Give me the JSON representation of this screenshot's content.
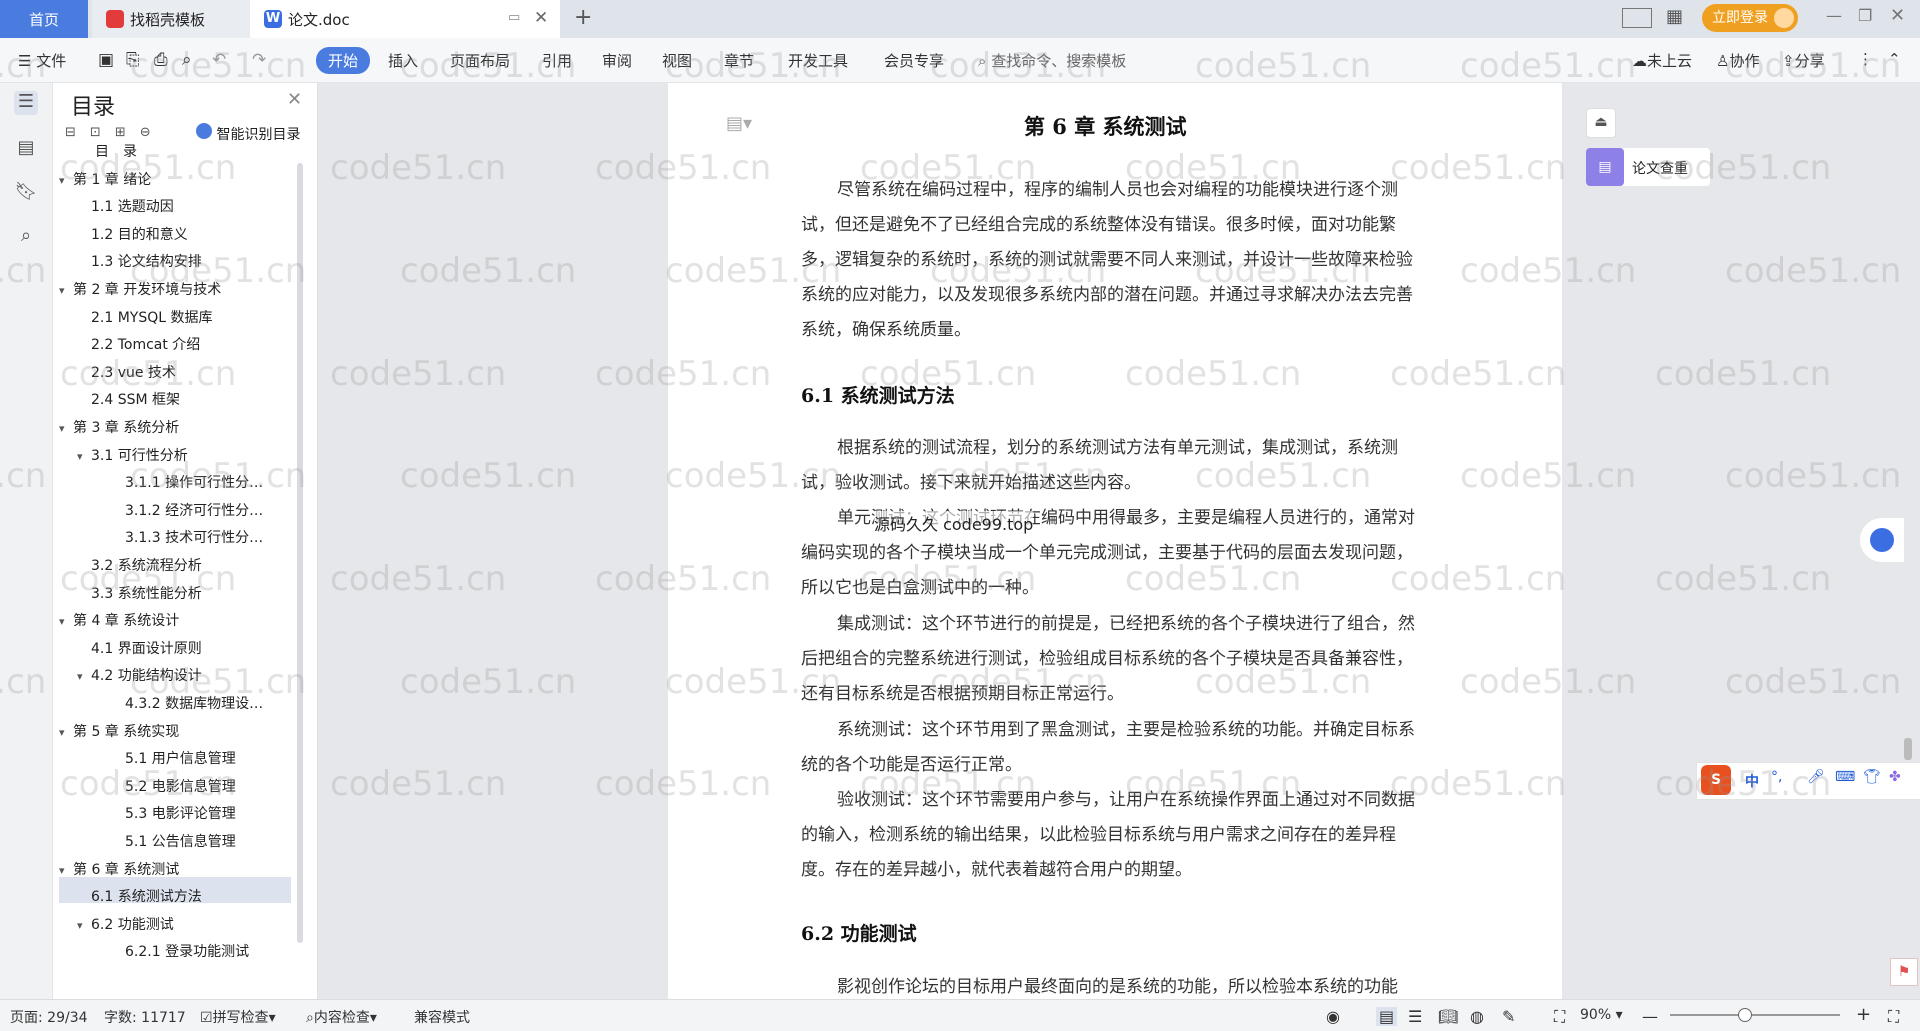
{
  "tabs": {
    "home": "首页",
    "template": "找稻壳模板",
    "doc": "论文.doc",
    "login": "立即登录"
  },
  "toolbar": {
    "file": "文件",
    "menus": [
      "开始",
      "插入",
      "页面布局",
      "引用",
      "审阅",
      "视图",
      "章节",
      "开发工具",
      "会员专享"
    ],
    "search_placeholder": "查找命令、搜索模板",
    "cloud": "未上云",
    "collab": "协作",
    "share": "分享"
  },
  "outline": {
    "title": "目录",
    "smart": "智能识别目录",
    "items": [
      "目　录",
      "第 1 章  绪论",
      "1.1 选题动因",
      "1.2 目的和意义",
      "1.3 论文结构安排",
      "第 2 章  开发环境与技术",
      "2.1 MYSQL 数据库",
      "2.2 Tomcat 介绍",
      "2.3 vue 技术",
      "2.4 SSM 框架",
      "第 3 章  系统分析",
      "3.1 可行性分析",
      "3.1.1 操作可行性分…",
      "3.1.2 经济可行性分…",
      "3.1.3 技术可行性分…",
      "3.2 系统流程分析",
      "3.3 系统性能分析",
      "第 4 章  系统设计",
      "4.1 界面设计原则",
      "4.2 功能结构设计",
      "4.3.2  数据库物理设…",
      "第 5 章  系统实现",
      "5.1 用户信息管理",
      "5.2  电影信息管理",
      "5.3 电影评论管理",
      "5.1 公告信息管理",
      "第 6 章  系统测试",
      "6.1  系统测试方法",
      "6.2  功能测试",
      "6.2.1  登录功能测试"
    ]
  },
  "document": {
    "chapter_title": "第 6 章  系统测试",
    "intro": "尽管系统在编码过程中，程序的编制人员也会对编程的功能模块进行逐个测试，但还是避免不了已经组合完成的系统整体没有错误。很多时候，面对功能繁多，逻辑复杂的系统时，系统的测试就需要不同人来测试，并设计一些故障来检验系统的应对能力，以及发现很多系统内部的潜在问题。并通过寻求解决办法去完善系统，确保系统质量。",
    "h61": "6.1  系统测试方法",
    "p1": "根据系统的测试流程，划分的系统测试方法有单元测试，集成测试，系统测试，验收测试。接下来就开始描述这些内容。",
    "p2": "单元测试：这个测试环节在编码中用得最多，主要是编程人员进行的，通常对编码实现的各个子模块当成一个单元完成测试，主要基于代码的层面去发现问题，所以它也是白盒测试中的一种。",
    "p3": "集成测试：这个环节进行的前提是，已经把系统的各个子模块进行了组合，然后把组合的完整系统进行测试，检验组成目标系统的各个子模块是否具备兼容性，还有目标系统是否根据预期目标正常运行。",
    "p4": "系统测试：这个环节用到了黑盒测试，主要是检验系统的功能。并确定目标系统的各个功能是否运行正常。",
    "p5": "验收测试：这个环节需要用户参与，让用户在系统操作界面上通过对不同数据的输入，检测系统的输出结果，以此检验目标系统与用户需求之间存在的差异程度。存在的差异越小，就代表着越符合用户的期望。",
    "h62": "6.2  功能测试",
    "p6": "影视创作论坛的目标用户最终面向的是系统的功能，所以检验本系统的功能",
    "overlay": "源码久久  code99.top"
  },
  "right_panel": {
    "check": "论文查重"
  },
  "ime": [
    "中",
    "°,"
  ],
  "watermark": "code51.cn",
  "status": {
    "page": "页面: 29/34",
    "words": "字数: 11717",
    "spell": "拼写检查",
    "content": "内容检查",
    "compat": "兼容模式",
    "zoom": "90%"
  },
  "colors": {
    "accent": "#4a7ce0",
    "login": "#f0a020"
  }
}
